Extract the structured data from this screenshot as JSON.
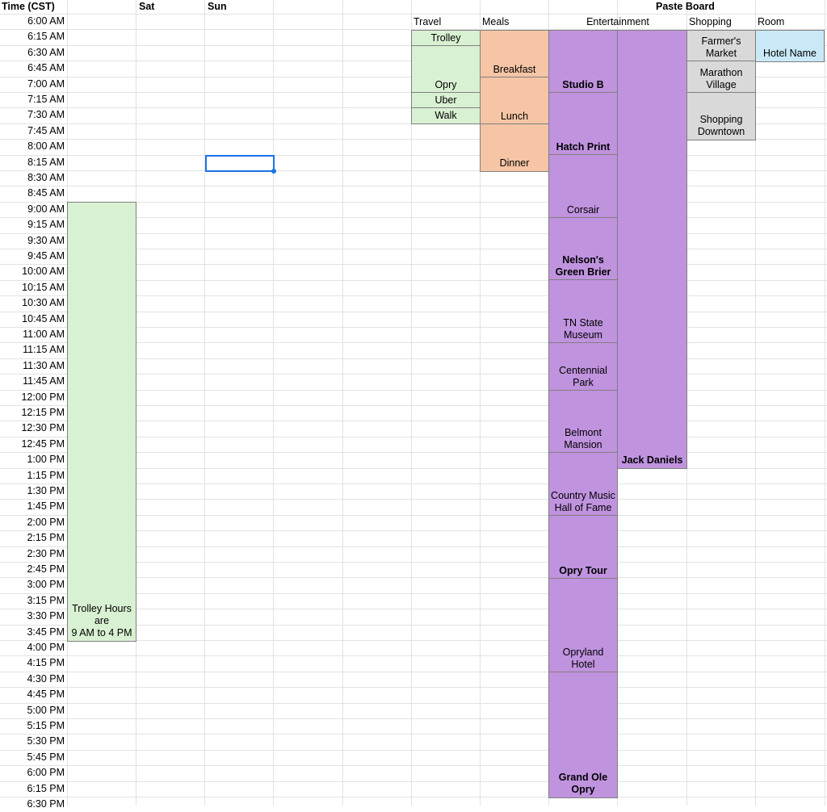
{
  "headers": {
    "time": "Time (CST)",
    "sat": "Sat",
    "sun": "Sun",
    "paste_board": "Paste Board",
    "travel": "Travel",
    "meals": "Meals",
    "entertainment": "Entertainment",
    "shopping": "Shopping",
    "room": "Room"
  },
  "times": [
    "6:00 AM",
    "6:15 AM",
    "6:30 AM",
    "6:45 AM",
    "7:00 AM",
    "7:15 AM",
    "7:30 AM",
    "7:45 AM",
    "8:00 AM",
    "8:15 AM",
    "8:30 AM",
    "8:45 AM",
    "9:00 AM",
    "9:15 AM",
    "9:30 AM",
    "9:45 AM",
    "10:00 AM",
    "10:15 AM",
    "10:30 AM",
    "10:45 AM",
    "11:00 AM",
    "11:15 AM",
    "11:30 AM",
    "11:45 AM",
    "12:00 PM",
    "12:15 PM",
    "12:30 PM",
    "12:45 PM",
    "1:00 PM",
    "1:15 PM",
    "1:30 PM",
    "1:45 PM",
    "2:00 PM",
    "2:15 PM",
    "2:30 PM",
    "2:45 PM",
    "3:00 PM",
    "3:15 PM",
    "3:30 PM",
    "3:45 PM",
    "4:00 PM",
    "4:15 PM",
    "4:30 PM",
    "4:45 PM",
    "5:00 PM",
    "5:15 PM",
    "5:30 PM",
    "5:45 PM",
    "6:00 PM",
    "6:15 PM",
    "6:30 PM"
  ],
  "colors": {
    "green": "#d9f1d3",
    "peach": "#f6c5a5",
    "purple": "#c093df",
    "gray": "#d9d9d9",
    "blue": "#c9e9f7",
    "selection": "#1a73e8",
    "gridline": "#e2e2e2"
  },
  "blocks": {
    "trolley_hours": "Trolley Hours\nare\n9 AM to 4 PM",
    "travel": [
      "Trolley",
      "Opry",
      "Uber",
      "Walk"
    ],
    "meals": [
      "Breakfast",
      "Lunch",
      "Dinner"
    ],
    "entertainment": [
      "Studio B",
      "Hatch Print",
      "Corsair",
      "Nelson's\nGreen Brier",
      "TN State\nMuseum",
      "Centennial\nPark",
      "Belmont\nMansion",
      "Country Music\nHall of Fame",
      "Opry Tour",
      "Opryland\nHotel",
      "Grand Ole\nOpry"
    ],
    "jack_daniels": "Jack Daniels",
    "shopping": [
      "Farmer's\nMarket",
      "Marathon\nVillage",
      "Shopping\nDowntown"
    ],
    "room": "Hotel Name"
  }
}
